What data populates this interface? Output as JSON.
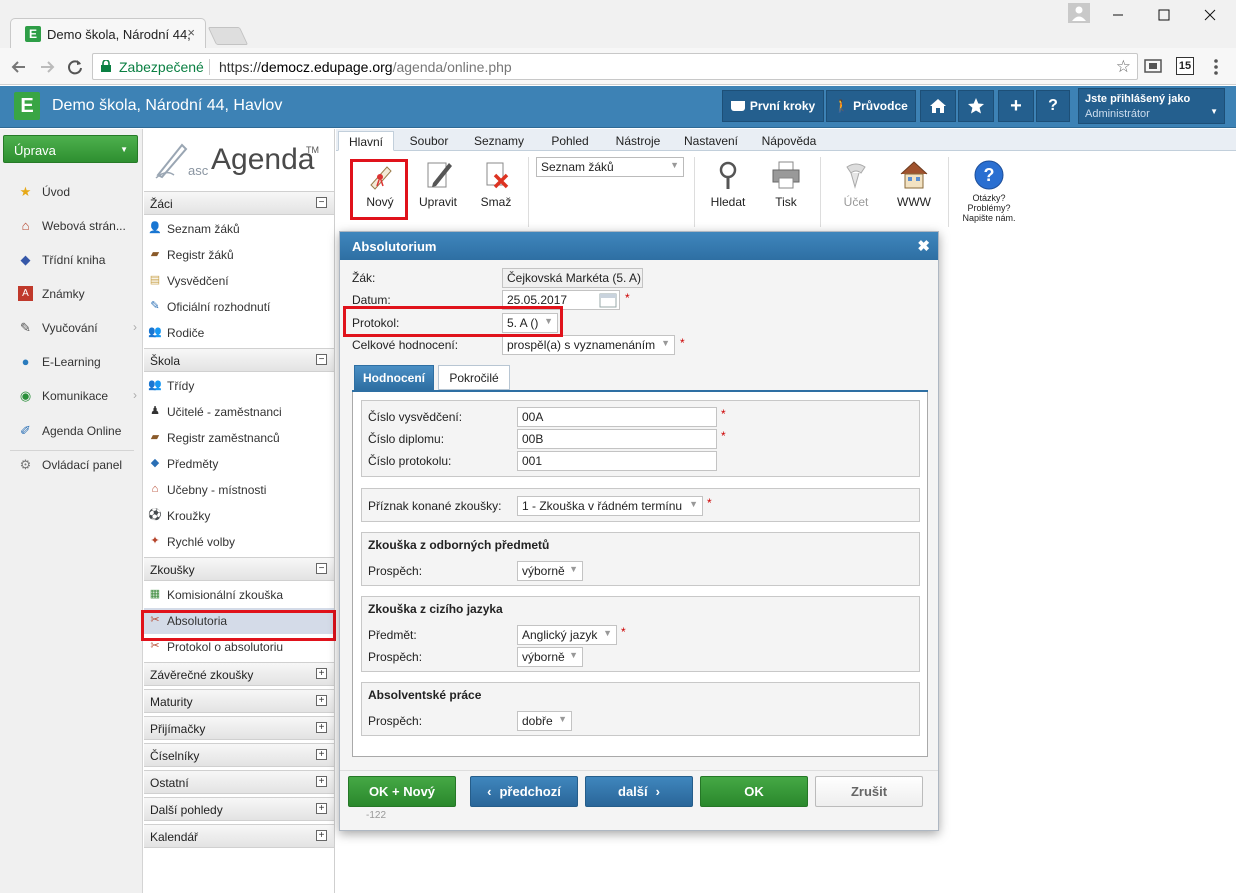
{
  "browser": {
    "tab_title": "Demo škola, Národní 44,",
    "tab_close": "×",
    "security_label": "Zabezpečené",
    "url_prefix": "https://",
    "url_host": "democz.edupage.org",
    "url_path": "/agenda/online.php",
    "ext_badge": "15"
  },
  "header": {
    "logo_letter": "E",
    "school_title": "Demo škola, Národní 44, Havlov",
    "first_steps": "První kroky",
    "guide": "Průvodce",
    "help": "?",
    "add": "+",
    "user_label": "Jste přihlášený jako",
    "user_name": "Administrátor"
  },
  "sidebar": {
    "uprava": "Úprava",
    "items": [
      {
        "label": "Úvod",
        "icon": "star-icon"
      },
      {
        "label": "Webová strán...",
        "icon": "web-icon"
      },
      {
        "label": "Třídní kniha",
        "icon": "book-icon"
      },
      {
        "label": "Známky",
        "icon": "grades-icon"
      },
      {
        "label": "Vyučování",
        "icon": "teaching-icon"
      },
      {
        "label": "E-Learning",
        "icon": "elearning-icon"
      },
      {
        "label": "Komunikace",
        "icon": "communication-icon"
      },
      {
        "label": "Agenda Online",
        "icon": "agenda-icon"
      },
      {
        "label": "Ovládací panel",
        "icon": "control-panel-icon"
      }
    ]
  },
  "agenda": {
    "logo_prefix": "asc",
    "logo_text": "Agenda",
    "logo_tm": "TM",
    "sections": {
      "zaci": "Žáci",
      "skola": "Škola",
      "zkousky": "Zkoušky",
      "zaverecne": "Závěrečné zkoušky",
      "maturity": "Maturity",
      "prijimacky": "Přijímačky",
      "ciselniky": "Číselníky",
      "ostatni": "Ostatní",
      "dalsi": "Další pohledy",
      "kalendar": "Kalendář"
    },
    "zaci_items": [
      "Seznam žáků",
      "Registr žáků",
      "Vysvědčení",
      "Oficiální rozhodnutí",
      "Rodiče"
    ],
    "skola_items": [
      "Třídy",
      "Učitelé - zaměstnanci",
      "Registr zaměstnanců",
      "Předměty",
      "Učebny - místnosti",
      "Kroužky",
      "Rychlé volby"
    ],
    "zkousky_items": [
      "Komisionální zkouška",
      "Absolutoria",
      "Protokol o absolutoriu"
    ]
  },
  "ribbon": {
    "tabs": [
      "Hlavní",
      "Soubor",
      "Seznamy",
      "Pohled",
      "Nástroje",
      "Nastavení",
      "Nápověda"
    ],
    "novy": "Nový",
    "upravit": "Upravit",
    "smaz": "Smaž",
    "list_select": "Seznam žáků",
    "hledat": "Hledat",
    "tisk": "Tisk",
    "ucet": "Účet",
    "www": "WWW",
    "help_line1": "Otázky?",
    "help_line2": "Problémy?",
    "help_line3": "Napište nám."
  },
  "dialog": {
    "title": "Absolutorium",
    "zak_label": "Žák:",
    "zak_value": "Čejkovská Markéta (5. A)",
    "datum_label": "Datum:",
    "datum_value": "25.05.2017",
    "protokol_label": "Protokol:",
    "protokol_value": "5. A ()",
    "celkove_label": "Celkové hodnocení:",
    "celkove_value": "prospěl(a) s vyznamenáním",
    "tab_hodnoceni": "Hodnocení",
    "tab_pokrocile": "Pokročilé",
    "cislo_vysvedceni_label": "Číslo vysvědčení:",
    "cislo_vysvedceni_value": "00A",
    "cislo_diplomu_label": "Číslo diplomu:",
    "cislo_diplomu_value": "00B",
    "cislo_protokolu_label": "Číslo protokolu:",
    "cislo_protokolu_value": "001",
    "priznak_label": "Příznak konané zkoušky:",
    "priznak_value": "1 - Zkouška v řádném termínu",
    "odborne_title": "Zkouška z odborných předmetů",
    "prospech_label": "Prospěch:",
    "odborne_prospech": "výborně",
    "cizi_title": "Zkouška z cizího jazyka",
    "predmet_label": "Předmět:",
    "cizi_predmet": "Anglický jazyk",
    "cizi_prospech": "výborně",
    "prace_title": "Absolventské práce",
    "prace_prospech": "dobře",
    "btn_ok_novy": "OK + Nový",
    "btn_predchozi": "předchozí",
    "btn_dalsi": "další",
    "btn_ok": "OK",
    "btn_zrusit": "Zrušit",
    "record_id": "-122",
    "required_mark": "*"
  }
}
